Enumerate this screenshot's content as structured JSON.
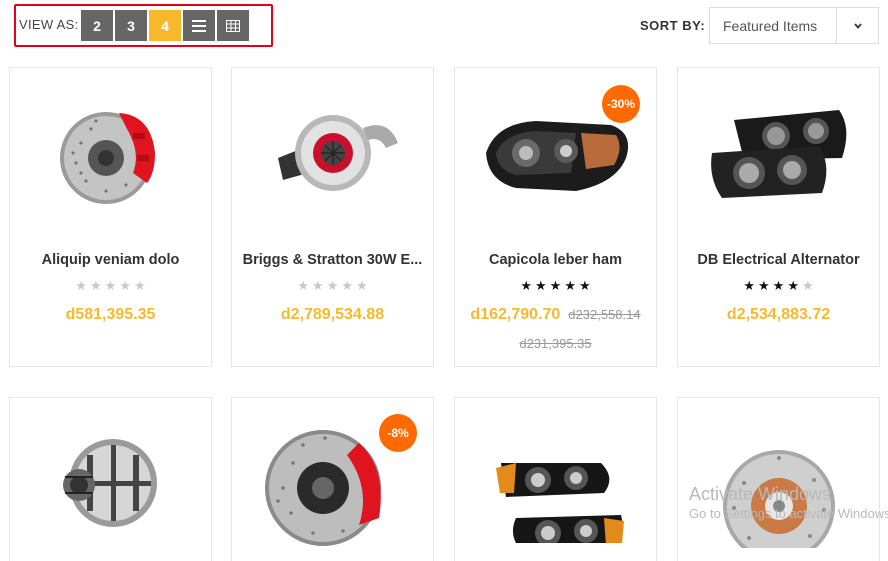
{
  "view_as": {
    "label": "VIEW AS:",
    "options": [
      "2",
      "3",
      "4"
    ],
    "active": "4",
    "list_icon": "list-icon",
    "table_icon": "table-icon",
    "highlight_color": "#e3001b",
    "active_color": "#f7b92b"
  },
  "sort": {
    "label": "SORT BY:",
    "selected": "Featured Items",
    "caret_icon": "chevron-down-icon"
  },
  "products": [
    {
      "title": "Aliquip veniam dolo",
      "rating": 0,
      "price": "d581,395.35",
      "old_price": "",
      "old_price_2": "",
      "badge": "",
      "image": "brake-caliper-disc"
    },
    {
      "title": "Briggs & Stratton 30W E...",
      "rating": 0,
      "price": "d2,789,534.88",
      "old_price": "",
      "old_price_2": "",
      "badge": "",
      "image": "turbocharger"
    },
    {
      "title": "Capicola leber ham",
      "rating": 5,
      "price": "d162,790.70",
      "old_price": "d232,558.14",
      "old_price_2": "d231,395.35",
      "badge": "-30%",
      "image": "headlight"
    },
    {
      "title": "DB Electrical Alternator",
      "rating": 4,
      "price": "d2,534,883.72",
      "old_price": "",
      "old_price_2": "",
      "badge": "",
      "image": "headlight-pair"
    },
    {
      "title": "",
      "rating": 0,
      "price": "",
      "old_price": "",
      "old_price_2": "",
      "badge": "",
      "image": "alternator"
    },
    {
      "title": "",
      "rating": 0,
      "price": "",
      "old_price": "",
      "old_price_2": "",
      "badge": "-8%",
      "image": "brembo-brake-disc"
    },
    {
      "title": "",
      "rating": 0,
      "price": "",
      "old_price": "",
      "old_price_2": "",
      "badge": "",
      "image": "headlight-set"
    },
    {
      "title": "",
      "rating": 0,
      "price": "",
      "old_price": "",
      "old_price_2": "",
      "badge": "",
      "image": "rotor-disc"
    }
  ],
  "watermark": {
    "line1": "Activate Windows",
    "line2": "Go to Settings to activate Windows."
  }
}
